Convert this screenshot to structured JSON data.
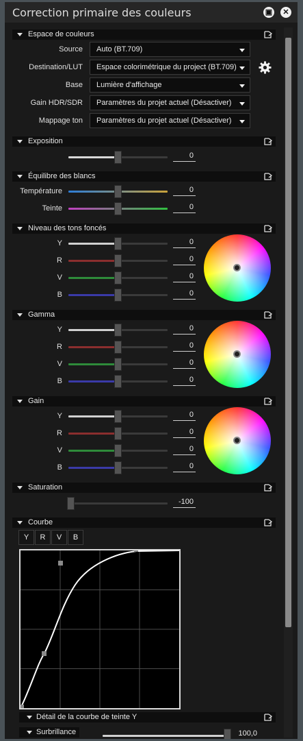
{
  "window": {
    "title": "Correction primaire des couleurs"
  },
  "colorspace": {
    "label": "Espace de couleurs",
    "fields": [
      {
        "label": "Source",
        "value": "Auto (BT.709)"
      },
      {
        "label": "Destination/LUT",
        "value": "Espace colorimétrique du project (BT.709)"
      },
      {
        "label": "Base",
        "value": "Lumière d'affichage"
      },
      {
        "label": "Gain HDR/SDR",
        "value": "Paramètres du projet actuel (Désactiver)"
      },
      {
        "label": "Mappage ton",
        "value": "Paramètres du projet actuel (Désactiver)"
      }
    ]
  },
  "exposure": {
    "label": "Exposition",
    "value": "0"
  },
  "whitebalance": {
    "label": "Équilibre des blancs",
    "rows": [
      {
        "label": "Température",
        "value": "0"
      },
      {
        "label": "Teinte",
        "value": "0"
      }
    ]
  },
  "shadows": {
    "label": "Niveau des tons foncés",
    "rows": [
      {
        "label": "Y",
        "value": "0"
      },
      {
        "label": "R",
        "value": "0"
      },
      {
        "label": "V",
        "value": "0"
      },
      {
        "label": "B",
        "value": "0"
      }
    ]
  },
  "gamma": {
    "label": "Gamma",
    "rows": [
      {
        "label": "Y",
        "value": "0"
      },
      {
        "label": "R",
        "value": "0"
      },
      {
        "label": "V",
        "value": "0"
      },
      {
        "label": "B",
        "value": "0"
      }
    ]
  },
  "gain": {
    "label": "Gain",
    "rows": [
      {
        "label": "Y",
        "value": "0"
      },
      {
        "label": "R",
        "value": "0"
      },
      {
        "label": "V",
        "value": "0"
      },
      {
        "label": "B",
        "value": "0"
      }
    ]
  },
  "saturation": {
    "label": "Saturation",
    "value": "-100"
  },
  "curve": {
    "label": "Courbe",
    "tabs": [
      "Y",
      "R",
      "V",
      "B"
    ]
  },
  "hue_curve": {
    "label": "Détail de la courbe de teinte Y"
  },
  "highlight": {
    "label": "Surbrillance",
    "value": "100,0"
  },
  "colors": {
    "panel_bg": "#1a1a1a",
    "header_bg": "#0e0e0e",
    "track_y": "#d0d0d0",
    "track_r": "#8b2e2e",
    "track_v": "#2e8b3a",
    "track_b": "#3a3aa8"
  }
}
